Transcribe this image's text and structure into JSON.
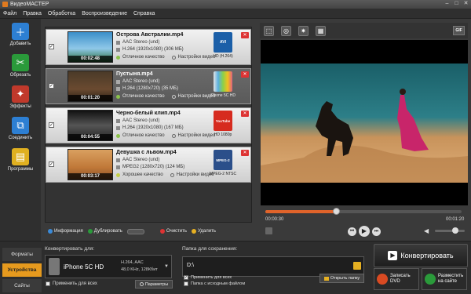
{
  "window": {
    "title": "ВидеоМАСТЕР"
  },
  "menu": [
    "Файл",
    "Правка",
    "Обработка",
    "Воспроизведение",
    "Справка"
  ],
  "sidebar": [
    {
      "label": "Добавить",
      "color": "#2d7fd3",
      "icon": "add-video-icon"
    },
    {
      "label": "Обрезать",
      "color": "#2a9a3a",
      "icon": "scissors-icon"
    },
    {
      "label": "Эффекты",
      "color": "#c0392b",
      "icon": "effects-icon"
    },
    {
      "label": "Соединить",
      "color": "#2d7fd3",
      "icon": "join-icon"
    },
    {
      "label": "Программы",
      "color": "#e0b020",
      "icon": "programs-icon"
    }
  ],
  "files": [
    {
      "name": "Острова Австралии.mp4",
      "audio": "AAC Stereo (und)",
      "video": "H.264 (1920x1080) (306 МБ)",
      "quality": "Отличное качество",
      "settings": "Настройки видео",
      "duration": "00:02:48",
      "device": "HD (H.264)",
      "badge": "AVI",
      "badge_color": "#1b5fa8",
      "thumb": "linear-gradient(#3b8fc9,#8fc8e8 55%,#2b6f3a)"
    },
    {
      "name": "Пустыня.mp4",
      "audio": "AAC Stereo (und)",
      "video": "H.264 (1280x720) (35 МБ)",
      "quality": "Отличное качество",
      "settings": "Настройки видео",
      "duration": "00:01:20",
      "device": "iPhone 5C HD",
      "badge": "",
      "badge_color": "#5ab0e0",
      "thumb": "linear-gradient(#4a3a28,#6a4a30 60%,#2a1e14)"
    },
    {
      "name": "Черно-белый клип.mp4",
      "audio": "AAC Stereo (und)",
      "video": "H.264 (1920x1080) (167 МБ)",
      "quality": "Отличное качество",
      "settings": "Настройки видео",
      "duration": "00:04:55",
      "device": "HD 1080p",
      "badge": "YouTube",
      "badge_color": "#d62b1f",
      "thumb": "linear-gradient(#111,#555 50%,#222)"
    },
    {
      "name": "Девушка с львом.mp4",
      "audio": "AAC Stereo (und)",
      "video": "MPEG2 (1280x720) (124 МБ)",
      "quality": "Хорошее качество",
      "settings": "Настройки видео",
      "duration": "00:03:17",
      "device": "MPEG-2 NTSC",
      "badge": "MPEG-2",
      "badge_color": "#2b4f8a",
      "thumb": "linear-gradient(#d9a060,#c07838 60%,#8a5028)"
    }
  ],
  "list_toolbar": {
    "info": "Информация",
    "duplicate": "Дублировать",
    "clear": "Очистить",
    "delete": "Удалить"
  },
  "player": {
    "time_current": "00:00:30",
    "time_total": "00:01:20",
    "progress": 0.36,
    "volume": 0.6
  },
  "bottom": {
    "tabs": [
      "Форматы",
      "Устройства",
      "Сайты"
    ],
    "active_tab": 1,
    "convert_for_label": "Конвертировать для:",
    "device_name": "iPhone 5C HD",
    "device_specs_1": "H.264, AAC",
    "device_specs_2": "48,0 KHz, 128Кбит",
    "apply_all": "Применить для всех",
    "params": "Параметры",
    "save_label": "Папка для сохранения:",
    "save_path": "D:\\",
    "save_apply_all": "Применить для всех",
    "source_folder": "Папка с исходным файлом",
    "open_folder": "Открыть папку",
    "convert": "Конвертировать",
    "burn_dvd_1": "Записать",
    "burn_dvd_2": "DVD",
    "share_1": "Разместить",
    "share_2": "на сайте"
  }
}
